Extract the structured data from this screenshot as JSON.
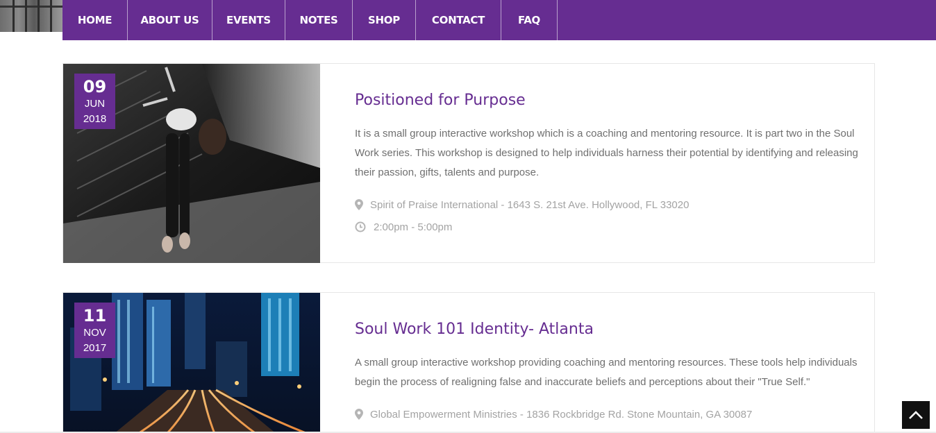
{
  "nav": {
    "items": [
      {
        "label": "HOME"
      },
      {
        "label": "ABOUT US"
      },
      {
        "label": "EVENTS"
      },
      {
        "label": "NOTES"
      },
      {
        "label": "SHOP"
      },
      {
        "label": "CONTACT"
      },
      {
        "label": "FAQ"
      }
    ]
  },
  "events": [
    {
      "day": "09",
      "month": "JUN",
      "year": "2018",
      "title": "Positioned for Purpose",
      "description": "It is a small group interactive workshop which is a coaching and mentoring resource. It is part two in the Soul Work series. This workshop is designed to help individuals harness their potential by identifying and releasing their passion, gifts, talents and purpose.",
      "location": "Spirit of Praise International - 1643 S. 21st Ave. Hollywood, FL 33020",
      "time": "2:00pm - 5:00pm",
      "location_icon": "map-marker-icon",
      "time_icon": "clock-icon"
    },
    {
      "day": "11",
      "month": "NOV",
      "year": "2017",
      "title": "Soul Work 101 Identity- Atlanta",
      "description": "A small group interactive workshop providing coaching and mentoring resources. These tools help individuals begin the process of realigning false and inaccurate beliefs and perceptions about their \"True Self.\"",
      "location": "Global Empowerment Ministries - 1836 Rockbridge Rd. Stone Mountain, GA 30087",
      "location_icon": "map-marker-icon"
    }
  ],
  "scroll_top_icon": "chevron-up-icon",
  "colors": {
    "brand": "#662d91",
    "text": "#6f6f6f",
    "meta": "#a3a3a3"
  }
}
